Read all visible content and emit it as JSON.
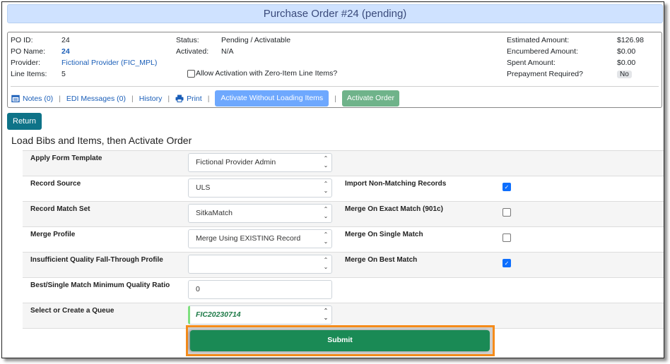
{
  "header": {
    "title": "Purchase Order #24 (pending)"
  },
  "po": {
    "left": [
      {
        "label": "PO ID:",
        "value": "24"
      },
      {
        "label": "PO Name:",
        "value": "24"
      },
      {
        "label": "Provider:",
        "value": "Fictional Provider (FIC_MPL)"
      },
      {
        "label": "Line Items:",
        "value": "5"
      }
    ],
    "middle": [
      {
        "label": "Status:",
        "value": "Pending / Activatable"
      },
      {
        "label": "Activated:",
        "value": "N/A"
      }
    ],
    "zero_item_label": "Allow Activation with Zero-Item Line Items?",
    "zero_item_checked": false,
    "right": [
      {
        "label": "Estimated Amount:",
        "value": "$126.98"
      },
      {
        "label": "Encumbered Amount:",
        "value": "$0.00"
      },
      {
        "label": "Spent Amount:",
        "value": "$0.00"
      },
      {
        "label": "Prepayment Required?",
        "value": "No"
      }
    ]
  },
  "actions": {
    "notes": "Notes (0)",
    "notes_icon": "calendar-icon",
    "edi": "EDI Messages (0)",
    "history": "History",
    "print": "Print",
    "print_icon": "printer-icon",
    "activate_without_loading": "Activate Without Loading Items",
    "activate_order": "Activate Order",
    "separator": "|"
  },
  "return_label": "Return",
  "section_title": "Load Bibs and Items, then Activate Order",
  "form": {
    "rows": [
      {
        "label": "Apply Form Template",
        "value": "Fictional Provider Admin",
        "type": "select",
        "right_label": "",
        "right_checked": null
      },
      {
        "label": "Record Source",
        "value": "ULS",
        "type": "select",
        "right_label": "Import Non-Matching Records",
        "right_checked": true
      },
      {
        "label": "Record Match Set",
        "value": "SitkaMatch",
        "type": "select",
        "right_label": "Merge On Exact Match (901c)",
        "right_checked": false
      },
      {
        "label": "Merge Profile",
        "value": "Merge Using EXISTING Record",
        "type": "select",
        "right_label": "Merge On Single Match",
        "right_checked": false
      },
      {
        "label": "Insufficient Quality Fall-Through Profile",
        "value": "",
        "type": "select",
        "right_label": "Merge On Best Match",
        "right_checked": true
      },
      {
        "label": "Best/Single Match Minimum Quality Ratio",
        "value": "0",
        "type": "input",
        "right_label": "",
        "right_checked": null
      },
      {
        "label": "Select or Create a Queue",
        "value": "FIC20230714",
        "type": "combobox",
        "right_label": "",
        "right_checked": null
      }
    ],
    "submit_label": "Submit",
    "select_arrows": "⌃⌄",
    "check_glyph": "✓"
  },
  "colors": {
    "title_bg": "#cfe2ff",
    "return_btn": "#0e7388",
    "submit_btn": "#1a8a55",
    "highlight": "#f58b1a",
    "checkbox_on": "#0d6efd"
  }
}
